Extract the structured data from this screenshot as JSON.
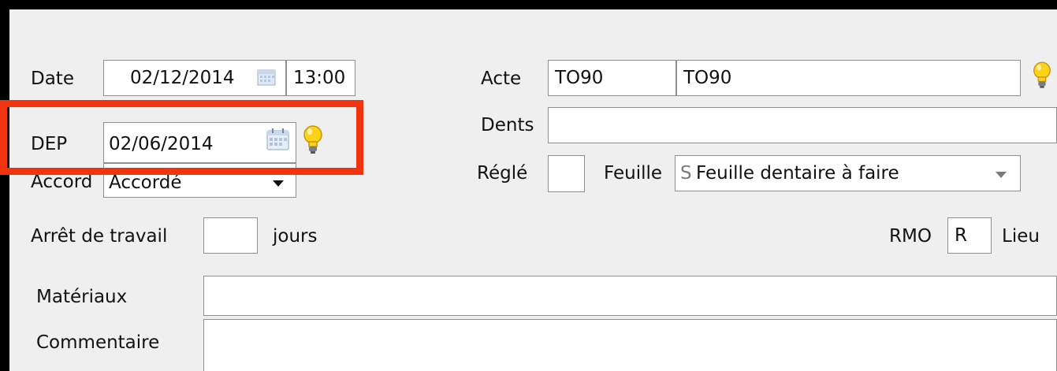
{
  "form": {
    "date": {
      "label": "Date",
      "value": "02/12/2014",
      "time": "13:00"
    },
    "dep": {
      "label": "DEP",
      "value": "02/06/2014"
    },
    "accord": {
      "label": "Accord",
      "value": "Accordé"
    },
    "arret": {
      "label": "Arrêt de travail",
      "value": "",
      "unit": "jours"
    },
    "acte": {
      "label": "Acte",
      "code": "TO90",
      "description": "TO90"
    },
    "dents": {
      "label": "Dents",
      "value": ""
    },
    "regle": {
      "label": "Réglé",
      "value": ""
    },
    "feuille": {
      "label": "Feuille",
      "prefix": "S",
      "value": "Feuille dentaire à faire"
    },
    "rmo": {
      "label": "RMO",
      "value": "R"
    },
    "lieu": {
      "label": "Lieu"
    },
    "materiaux": {
      "label": "Matériaux",
      "value": ""
    },
    "commentaire": {
      "label": "Commentaire",
      "value": ""
    }
  },
  "icons": {
    "calendar": "calendar-icon",
    "bulb": "lightbulb-icon",
    "dropdown": "chevron-down-icon"
  },
  "colors": {
    "highlight": "#f2330f",
    "bulb": "#ffd21a",
    "background": "#efefef"
  }
}
